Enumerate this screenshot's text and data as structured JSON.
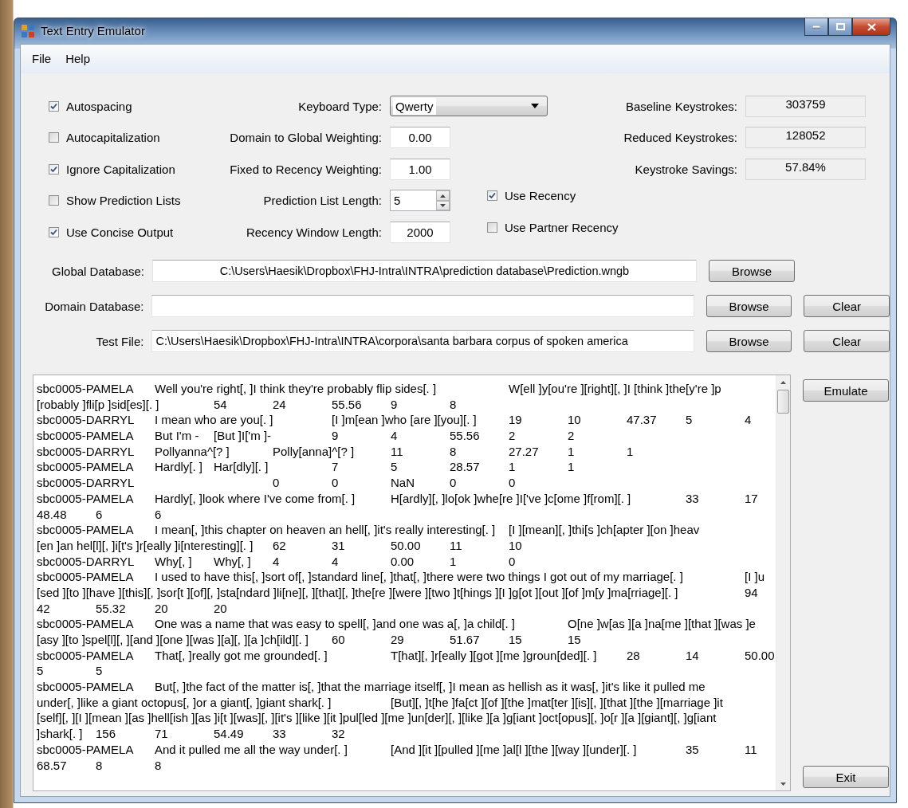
{
  "window": {
    "title": "Text Entry Emulator"
  },
  "menu": [
    "File",
    "Help"
  ],
  "options": [
    {
      "label": "Autospacing",
      "checked": true
    },
    {
      "label": "Autocapitalization",
      "checked": false
    },
    {
      "label": "Ignore Capitalization",
      "checked": true
    },
    {
      "label": "Show Prediction Lists",
      "checked": false
    },
    {
      "label": "Use Concise Output",
      "checked": true
    }
  ],
  "settings": [
    {
      "label": "Keyboard Type:",
      "kind": "dropdown",
      "value": "Qwerty"
    },
    {
      "label": "Domain to Global Weighting:",
      "kind": "text",
      "value": "0.00"
    },
    {
      "label": "Fixed to Recency Weighting:",
      "kind": "text",
      "value": "1.00"
    },
    {
      "label": "Prediction List Length:",
      "kind": "spinner",
      "value": "5"
    },
    {
      "label": "Recency Window Length:",
      "kind": "text",
      "value": "2000"
    }
  ],
  "recency_options": [
    {
      "label": "Use Recency",
      "checked": true
    },
    {
      "label": "Use Partner Recency",
      "checked": false
    }
  ],
  "stats": [
    {
      "label": "Baseline Keystrokes:",
      "value": "303759"
    },
    {
      "label": "Reduced Keystrokes:",
      "value": "128052"
    },
    {
      "label": "Keystroke Savings:",
      "value": "57.84%"
    }
  ],
  "files": [
    {
      "label": "Global Database:",
      "value": "C:\\Users\\Haesik\\Dropbox\\FHJ-Intra\\INTRA\\prediction database\\Prediction.wngb",
      "buttons": [
        "Browse"
      ]
    },
    {
      "label": "Domain Database:",
      "buttons": [
        "Browse",
        "Clear"
      ]
    },
    {
      "label": "Test File:",
      "value": "C:\\Users\\Haesik\\Dropbox\\FHJ-Intra\\INTRA\\corpora\\santa barbara corpus of spoken america",
      "buttons": [
        "Browse",
        "Clear"
      ]
    }
  ],
  "output_lines": [
    "sbc0005-PAMELA\tWell you're right[, ]I think they're probably flip sides[. ]\t\tW[ell ]y[ou're ][right][, ]I [think ]the[y're ]p",
    "[robably ]fli[p ]sid[es][. ]\t54\t24\t55.56\t9\t8",
    "sbc0005-DARRYL\tI mean who are you[. ]\t[I ]m[ean ]who [are ][you][. ]\t19\t10\t47.37\t5\t4",
    "sbc0005-PAMELA\tBut I'm -\t[But ]I['m ]-\t9\t4\t55.56\t2\t2",
    "sbc0005-DARRYL\tPollyanna^[? ]\tPolly[anna]^[? ]\t11\t8\t27.27\t1\t1",
    "sbc0005-PAMELA\tHardly[. ]\tHar[dly][. ]\t\t7\t5\t28.57\t1\t1",
    "sbc0005-DARRYL\t\t\t0\t0\tNaN\t0\t0",
    "sbc0005-PAMELA\tHardly[, ]look where I've come from[. ]\tH[ardly][, ]lo[ok ]whe[re ]I['ve ]c[ome ]f[rom][. ]\t33\t17",
    "48.48\t6\t6",
    "sbc0005-PAMELA\tI mean[, ]this chapter on heaven an hell[, ]it's really interesting[. ]\t[I ][mean][, ]thi[s ]ch[apter ][on ]heav",
    "[en ]an hel[l][, ]i[t's ]r[eally ]i[nteresting][. ]\t62\t31\t50.00\t11\t10",
    "sbc0005-DARRYL\tWhy[, ]\tWhy[, ]\t4\t4\t0.00\t1\t0",
    "sbc0005-PAMELA\tI used to have this[, ]sort of[, ]standard line[, ]that[, ]there were two things I got out of my marriage[. ]\t\t[I ]u",
    "[sed ][to ][have ][this][, ]sor[t ][of][, ]sta[ndard ]li[ne][, ][that][, ]the[re ][were ][two ]t[hings ][I ]g[ot ][out ][of ]m[y ]ma[rriage][. ]\t\t94",
    "42\t55.32\t20\t20",
    "sbc0005-PAMELA\tOne was a name that was easy to spell[, ]and one was a[, ]a child[. ]\tO[ne ]w[as ][a ]na[me ][that ][was ]e",
    "[asy ][to ]spel[l][, ][and ][one ][was ][a][, ][a ]ch[ild][. ]\t60\t29\t51.67\t15\t15",
    "sbc0005-PAMELA\tThat[, ]really got me grounded[. ]\t\tT[hat][, ]r[eally ][got ][me ]groun[ded][. ]\t28\t14\t50.00",
    "5\t5",
    "sbc0005-PAMELA\tBut[, ]the fact of the matter is[, ]that the marriage itself[, ]I mean as hellish as it was[, ]it's like it pulled me",
    "under[, ]like a giant octopus[, ]or a giant[, ]giant shark[. ]\t[But][, ]t[he ]fa[ct ][of ][the ]mat[ter ][is][, ][that ][the ][marriage ]it",
    "[self][, ][I ][mean ][as ]hell[ish ][as ]i[t ][was][, ][it's ][like ][it ]pul[led ][me ]un[der][, ][like ][a ]g[iant ]oct[opus][, ]o[r ][a ][giant][, ]g[iant",
    "]shark[. ]\t156\t71\t54.49\t33\t32",
    "sbc0005-PAMELA\tAnd it pulled me all the way under[. ]\t[And ][it ][pulled ][me ]al[l ][the ][way ][under][. ]\t35\t11",
    "68.57\t8\t8"
  ],
  "actions": {
    "emulate": "Emulate",
    "exit": "Exit"
  }
}
